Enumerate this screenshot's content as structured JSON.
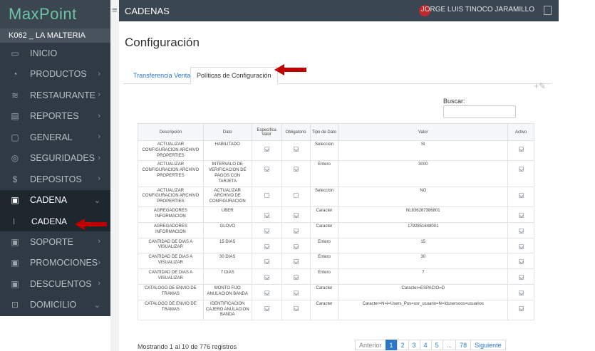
{
  "sidebar": {
    "logo": "MaxPoint",
    "store": "K062 _ LA MALTERIA",
    "items": [
      {
        "label": "INICIO"
      },
      {
        "label": "PRODUCTOS"
      },
      {
        "label": "RESTAURANTE"
      },
      {
        "label": "REPORTES"
      },
      {
        "label": "GENERAL"
      },
      {
        "label": "SEGURIDADES"
      },
      {
        "label": "DEPOSITOS"
      },
      {
        "label": "CADENA"
      },
      {
        "label": "CADENA"
      },
      {
        "label": "SOPORTE"
      },
      {
        "label": "PROMOCIONES"
      },
      {
        "label": "DESCUENTOS"
      },
      {
        "label": "DOMICILIO"
      }
    ]
  },
  "topbar": {
    "title": "CADENAS",
    "user": "JORGE LUIS TINOCO JARAMILLO"
  },
  "page": {
    "title": "Configuración",
    "tabs": [
      "Transferencia Venta",
      "Políticas de Configuración"
    ],
    "search_label": "Buscar:"
  },
  "table": {
    "headers": [
      "Descripción",
      "Dato",
      "Especifica Valor",
      "Obligatorio",
      "Tipo de Dato",
      "Valor",
      "Activo"
    ],
    "rows": [
      {
        "desc": "ACTUALIZAR CONFIGURACION ARCHIVO PROPERTIES",
        "dato": "HABILITADO",
        "esp": true,
        "obl": true,
        "tipo": "Seleccion",
        "valor": "SI",
        "act": true
      },
      {
        "desc": "ACTUALIZAR CONFIGURACION ARCHIVO PROPERTIES",
        "dato": "INTERVALO DE VERIFICACION DE PAGOS CON TARJETA",
        "esp": true,
        "obl": true,
        "tipo": "Entero",
        "valor": "3000",
        "act": true
      },
      {
        "desc": "ACTUALIZAR CONFIGURACION ARCHIVO PROPERTIES",
        "dato": "ACTUALIZAR ARCHIVO DE CONFIGURACION",
        "esp": false,
        "obl": false,
        "tipo": "Seleccion",
        "valor": "NO",
        "act": true
      },
      {
        "desc": "AGREGADORES INFORMACION",
        "dato": "UBER",
        "esp": true,
        "obl": true,
        "tipo": "Caracter",
        "valor": "NL836287386801",
        "act": true
      },
      {
        "desc": "AGREGADORES INFORMACION",
        "dato": "GLOVO",
        "esp": true,
        "obl": true,
        "tipo": "Caracter",
        "valor": "1792851648001",
        "act": true
      },
      {
        "desc": "CANTIDAD DE DIAS A VISUALIZAR",
        "dato": "15 DIAS",
        "esp": true,
        "obl": true,
        "tipo": "Entero",
        "valor": "15",
        "act": true
      },
      {
        "desc": "CANTIDAD DE DIAS A VISUALIZAR",
        "dato": "30 DIAS",
        "esp": true,
        "obl": true,
        "tipo": "Entero",
        "valor": "30",
        "act": true
      },
      {
        "desc": "CANTIDAD DE DIAS A VISUALIZAR",
        "dato": "7 DIAS",
        "esp": true,
        "obl": true,
        "tipo": "Entero",
        "valor": "7",
        "act": true
      },
      {
        "desc": "CATALOGO DE ENVIO DE TRAMAS",
        "dato": "MONTO FIJO ANULACION BANDA",
        "esp": true,
        "obl": true,
        "tipo": "Caracter",
        "valor": "Caracter=ESPACIO=D",
        "act": true
      },
      {
        "desc": "CATALOGO DE ENVIO DE TRAMAS",
        "dato": "IDENTIFICACION CAJERO ANULACION BANDA",
        "esp": true,
        "obl": true,
        "tipo": "Caracter",
        "valor": "Caracter=N=i=Users_Pos=usr_usuario=N=Idusersoos=usuarios",
        "act": true
      }
    ]
  },
  "footer": {
    "info": "Mostrando 1 al 10 de 776 registros",
    "prev": "Anterior",
    "pages": [
      "1",
      "2",
      "3",
      "4",
      "5",
      "...",
      "78"
    ],
    "next": "Siguiente"
  }
}
